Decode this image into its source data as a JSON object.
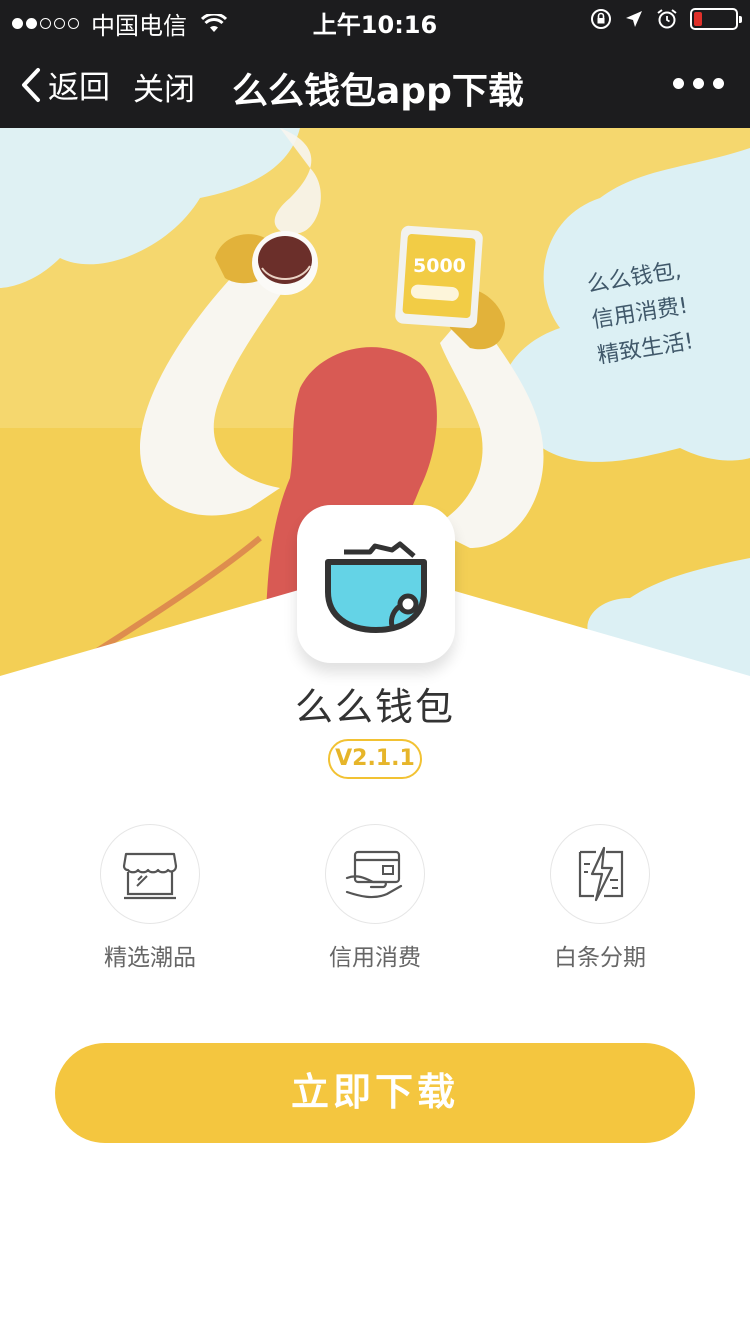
{
  "status_bar": {
    "carrier": "中国电信",
    "time": "上午10:16"
  },
  "nav": {
    "back_label": "返回",
    "close_label": "关闭",
    "title": "么么钱包app下载",
    "more_icon": "more-dots-icon"
  },
  "hero": {
    "slogan_lines": [
      "么么钱包,",
      "信用消费!",
      "精致生活!"
    ],
    "phone_amount": "5000"
  },
  "app": {
    "name": "么么钱包",
    "version": "V2.1.1",
    "icon": "wallet-icon"
  },
  "features": [
    {
      "label": "精选潮品",
      "icon": "store-icon"
    },
    {
      "label": "信用消费",
      "icon": "card-hand-icon"
    },
    {
      "label": "白条分期",
      "icon": "lightning-bill-icon"
    }
  ],
  "download": {
    "label": "立即下载"
  },
  "colors": {
    "accent": "#f4c63f",
    "nav_bg": "#1c1c1e",
    "hair": "#d85a54",
    "sky": "#dff0f4"
  }
}
